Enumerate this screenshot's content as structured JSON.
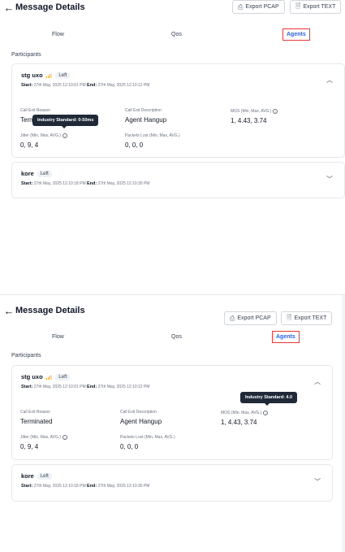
{
  "header": {
    "back_icon": "arrow-left-icon",
    "title": "Message Details",
    "export_pcap": "Export PCAP",
    "export_text": "Export TEXT"
  },
  "tabs": [
    "Flow",
    "Qos",
    "Agents"
  ],
  "participants_label": "Participants",
  "accent": "#2563eb",
  "highlight": "#e53935",
  "cards": [
    {
      "name": "stg uxo",
      "badge": "Left",
      "start_label": "Start:",
      "start": "27th May, 2025 12:10:01 PM",
      "end_label": "End:",
      "end": "27th May, 2025 12:10:12 PM",
      "fields": {
        "exit_reason_label": "Call Exit Reason",
        "exit_reason": "Terminated",
        "exit_desc_label": "Call Exit Description",
        "exit_desc": "Agent Hangup",
        "mos_label": "MOS (Min, Max, AVG.)",
        "mos": "1, 4.43, 3.74",
        "jitter_label": "Jitter (Min, Max, AVG.)",
        "jitter": "0, 9, 4",
        "packets_label": "Packets Lost (Min, Max, AVG.)",
        "packets": "0, 0, 0"
      }
    },
    {
      "name": "kore",
      "badge": "Left",
      "start_label": "Start:",
      "start": "27th May, 2025 12:10:18 PM",
      "end_label": "End:",
      "end": "27th May, 2025 12:10:30 PM"
    }
  ],
  "tooltips": {
    "jitter": "Industry Standard: 0-50ms",
    "mos": "Industry Standard: 4.0"
  },
  "truncated_exit_reason": "Term"
}
